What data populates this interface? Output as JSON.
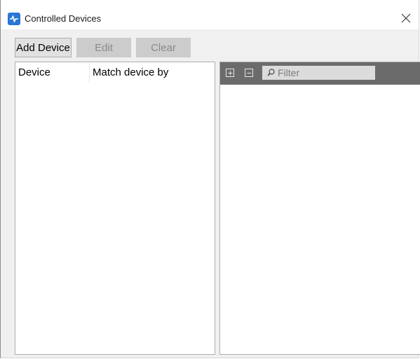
{
  "window": {
    "title": "Controlled Devices",
    "app_icon": "app-logo-icon",
    "close_icon": "close-icon"
  },
  "toolbar": {
    "add_device_label": "Add Device",
    "edit_label": "Edit",
    "clear_label": "Clear",
    "edit_enabled": false,
    "clear_enabled": false
  },
  "device_table": {
    "columns": [
      "Device",
      "Match device by"
    ],
    "rows": []
  },
  "tree_panel": {
    "expand_icon": "plus-box-icon",
    "collapse_icon": "minus-box-icon",
    "search_icon": "search-icon",
    "filter_placeholder": "Filter",
    "filter_value": ""
  },
  "colors": {
    "accent": "#2a76d6",
    "panel_toolbar": "#6b6b6b",
    "window_bg": "#f0f0f0",
    "disabled_button": "#cccccc"
  }
}
